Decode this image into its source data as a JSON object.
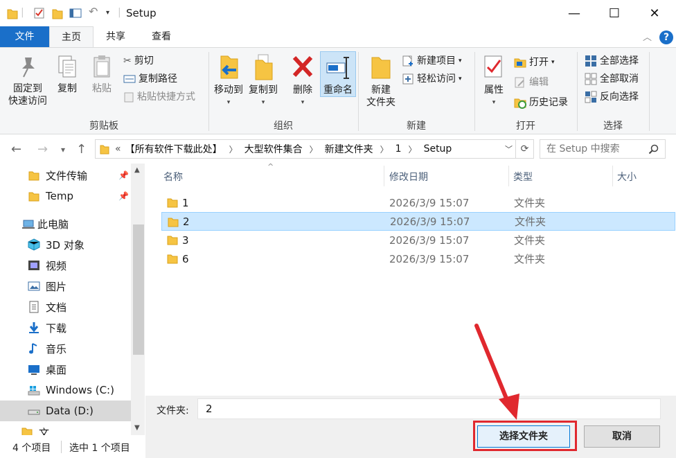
{
  "window": {
    "title": "Setup",
    "minimize_glyph": "—",
    "maximize_glyph": "☐",
    "close_glyph": "✕"
  },
  "ribbon_tabs": [
    {
      "label": "文件"
    },
    {
      "label": "主页"
    },
    {
      "label": "共享"
    },
    {
      "label": "查看"
    }
  ],
  "help_label": "?",
  "ribbon": {
    "clipboard": {
      "pin_label_1": "固定到",
      "pin_label_2": "快速访问",
      "copy_label": "复制",
      "paste_label": "粘贴",
      "cut_label": "剪切",
      "copy_path_label": "复制路径",
      "paste_shortcut_label": "粘贴快捷方式",
      "group_label": "剪贴板"
    },
    "organize": {
      "move_to_label": "移动到",
      "copy_to_label": "复制到",
      "delete_label": "删除",
      "rename_label": "重命名",
      "group_label": "组织"
    },
    "new": {
      "new_folder_label_1": "新建",
      "new_folder_label_2": "文件夹",
      "new_item_label": "新建项目",
      "easy_access_label": "轻松访问",
      "group_label": "新建"
    },
    "open": {
      "properties_label": "属性",
      "open_label": "打开",
      "edit_label": "编辑",
      "history_label": "历史记录",
      "group_label": "打开"
    },
    "select": {
      "select_all_label": "全部选择",
      "select_none_label": "全部取消",
      "invert_label": "反向选择",
      "group_label": "选择"
    }
  },
  "address": {
    "overflow": "«",
    "crumbs": [
      "【所有软件下载此处】",
      "大型软件集合",
      "新建文件夹",
      "1",
      "Setup"
    ],
    "search_placeholder": "在 Setup 中搜索"
  },
  "nav_pane": {
    "items": [
      {
        "label": "文件传输",
        "icon": "folder-icon",
        "pinned": true
      },
      {
        "label": "Temp",
        "icon": "folder-icon",
        "pinned": true
      },
      {
        "label": "此电脑",
        "icon": "computer-icon"
      },
      {
        "label": "3D 对象",
        "icon": "cube-icon"
      },
      {
        "label": "视频",
        "icon": "video-icon"
      },
      {
        "label": "图片",
        "icon": "picture-icon"
      },
      {
        "label": "文档",
        "icon": "document-icon"
      },
      {
        "label": "下载",
        "icon": "download-icon"
      },
      {
        "label": "音乐",
        "icon": "music-icon"
      },
      {
        "label": "桌面",
        "icon": "desktop-icon"
      },
      {
        "label": "Windows (C:)",
        "icon": "windows-drive-icon"
      },
      {
        "label": "Data (D:)",
        "icon": "drive-icon",
        "selected": true
      },
      {
        "label": "文",
        "icon": "folder-icon"
      }
    ]
  },
  "file_list": {
    "columns": [
      "名称",
      "修改日期",
      "类型",
      "大小"
    ],
    "rows": [
      {
        "name": "1",
        "date": "2026/3/9 15:07",
        "type": "文件夹"
      },
      {
        "name": "2",
        "date": "2026/3/9 15:07",
        "type": "文件夹",
        "selected": true
      },
      {
        "name": "3",
        "date": "2026/3/9 15:07",
        "type": "文件夹"
      },
      {
        "name": "6",
        "date": "2026/3/9 15:07",
        "type": "文件夹"
      }
    ]
  },
  "folder_field": {
    "label": "文件夹:",
    "value": "2"
  },
  "buttons": {
    "select_folder": "选择文件夹",
    "cancel": "取消"
  },
  "status_bar": {
    "item_count": "4 个项目",
    "selected_count": "选中 1 个项目"
  },
  "colors": {
    "accent": "#1a6fc9",
    "selection": "#cce8ff",
    "folder": "#f6c443",
    "annotation_red": "#e0282e"
  }
}
